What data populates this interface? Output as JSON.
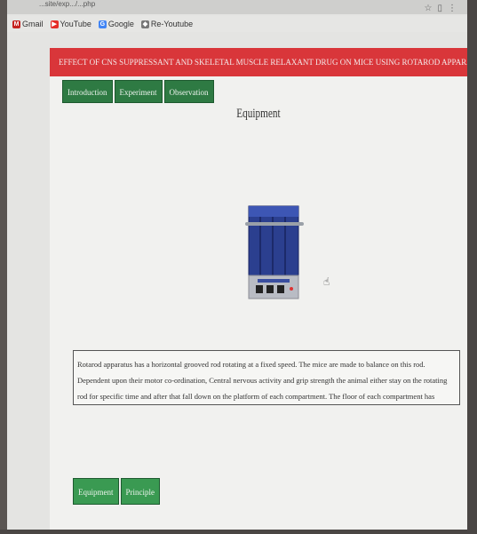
{
  "browser": {
    "address": "...site/exp.../...php",
    "bookmarks": [
      {
        "label": "Gmail",
        "icon": "gmail-icon",
        "color": "#c5221f",
        "glyph": "M"
      },
      {
        "label": "YouTube",
        "icon": "youtube-icon",
        "color": "#e52d27",
        "glyph": "▶"
      },
      {
        "label": "Google",
        "icon": "google-icon",
        "color": "#4285f4",
        "glyph": "G"
      },
      {
        "label": "Re-Youtube",
        "icon": "bookmark-icon",
        "color": "#777777",
        "glyph": "◆"
      }
    ]
  },
  "header": {
    "title": "Effect of CNS suppressant and skeletal muscle relaxant drug on mice using rotarod apparatus"
  },
  "tabs": [
    {
      "label": "Introduction"
    },
    {
      "label": "Experiment"
    },
    {
      "label": "Observation"
    }
  ],
  "main": {
    "heading": "Equipment",
    "apparatus_image": "rotarod-apparatus-image",
    "description": "Rotarod apparatus has a horizontal grooved rod rotating at a fixed speed. The mice are made to balance on this rod. Dependent upon their motor co-ordination, Central nervous activity and grip strength the animal either stay on the rotating rod for specific time and after that fall down on the platform of each compartment. The floor of each compartment has sensors that deactivate the timers and the exact fall off time for each rat is displayed on the respective display."
  },
  "bottom_buttons": [
    {
      "label": "Equipment"
    },
    {
      "label": "Principle"
    }
  ],
  "colors": {
    "title_bar": "#d9363a",
    "button": "#2e7a43"
  }
}
